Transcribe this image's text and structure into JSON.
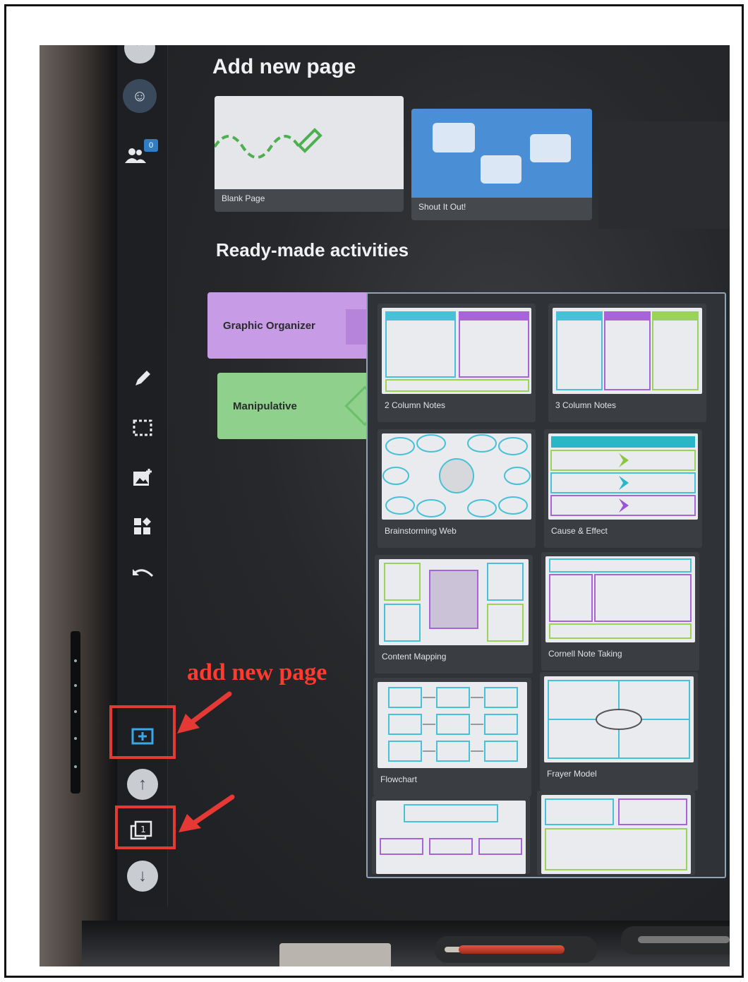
{
  "header": {
    "add_new_page": "Add new page",
    "ready_made": "Ready-made activities"
  },
  "toolbar": {
    "participants_count": "0",
    "page_number": "1"
  },
  "page_types": [
    {
      "label": "Blank Page"
    },
    {
      "label": "Shout It Out!"
    }
  ],
  "categories": [
    {
      "label": "Graphic Organizer",
      "color": "#c79be6"
    },
    {
      "label": "Manipulative",
      "color": "#8fd18c"
    }
  ],
  "templates": [
    {
      "label": "2 Column Notes"
    },
    {
      "label": "3 Column Notes"
    },
    {
      "label": "Brainstorming Web"
    },
    {
      "label": "Cause & Effect"
    },
    {
      "label": "Content Mapping"
    },
    {
      "label": "Cornell Note Taking"
    },
    {
      "label": "Flowchart"
    },
    {
      "label": "Frayer Model"
    }
  ],
  "annotation": {
    "label": "add new page",
    "color": "#e53935"
  },
  "icons": [
    "chevron-up-icon",
    "avatar-icon",
    "participants-icon",
    "pen-icon",
    "select-icon",
    "insert-image-icon",
    "widgets-icon",
    "undo-icon",
    "add-page-icon",
    "arrow-up-icon",
    "pages-icon",
    "arrow-down-icon"
  ]
}
